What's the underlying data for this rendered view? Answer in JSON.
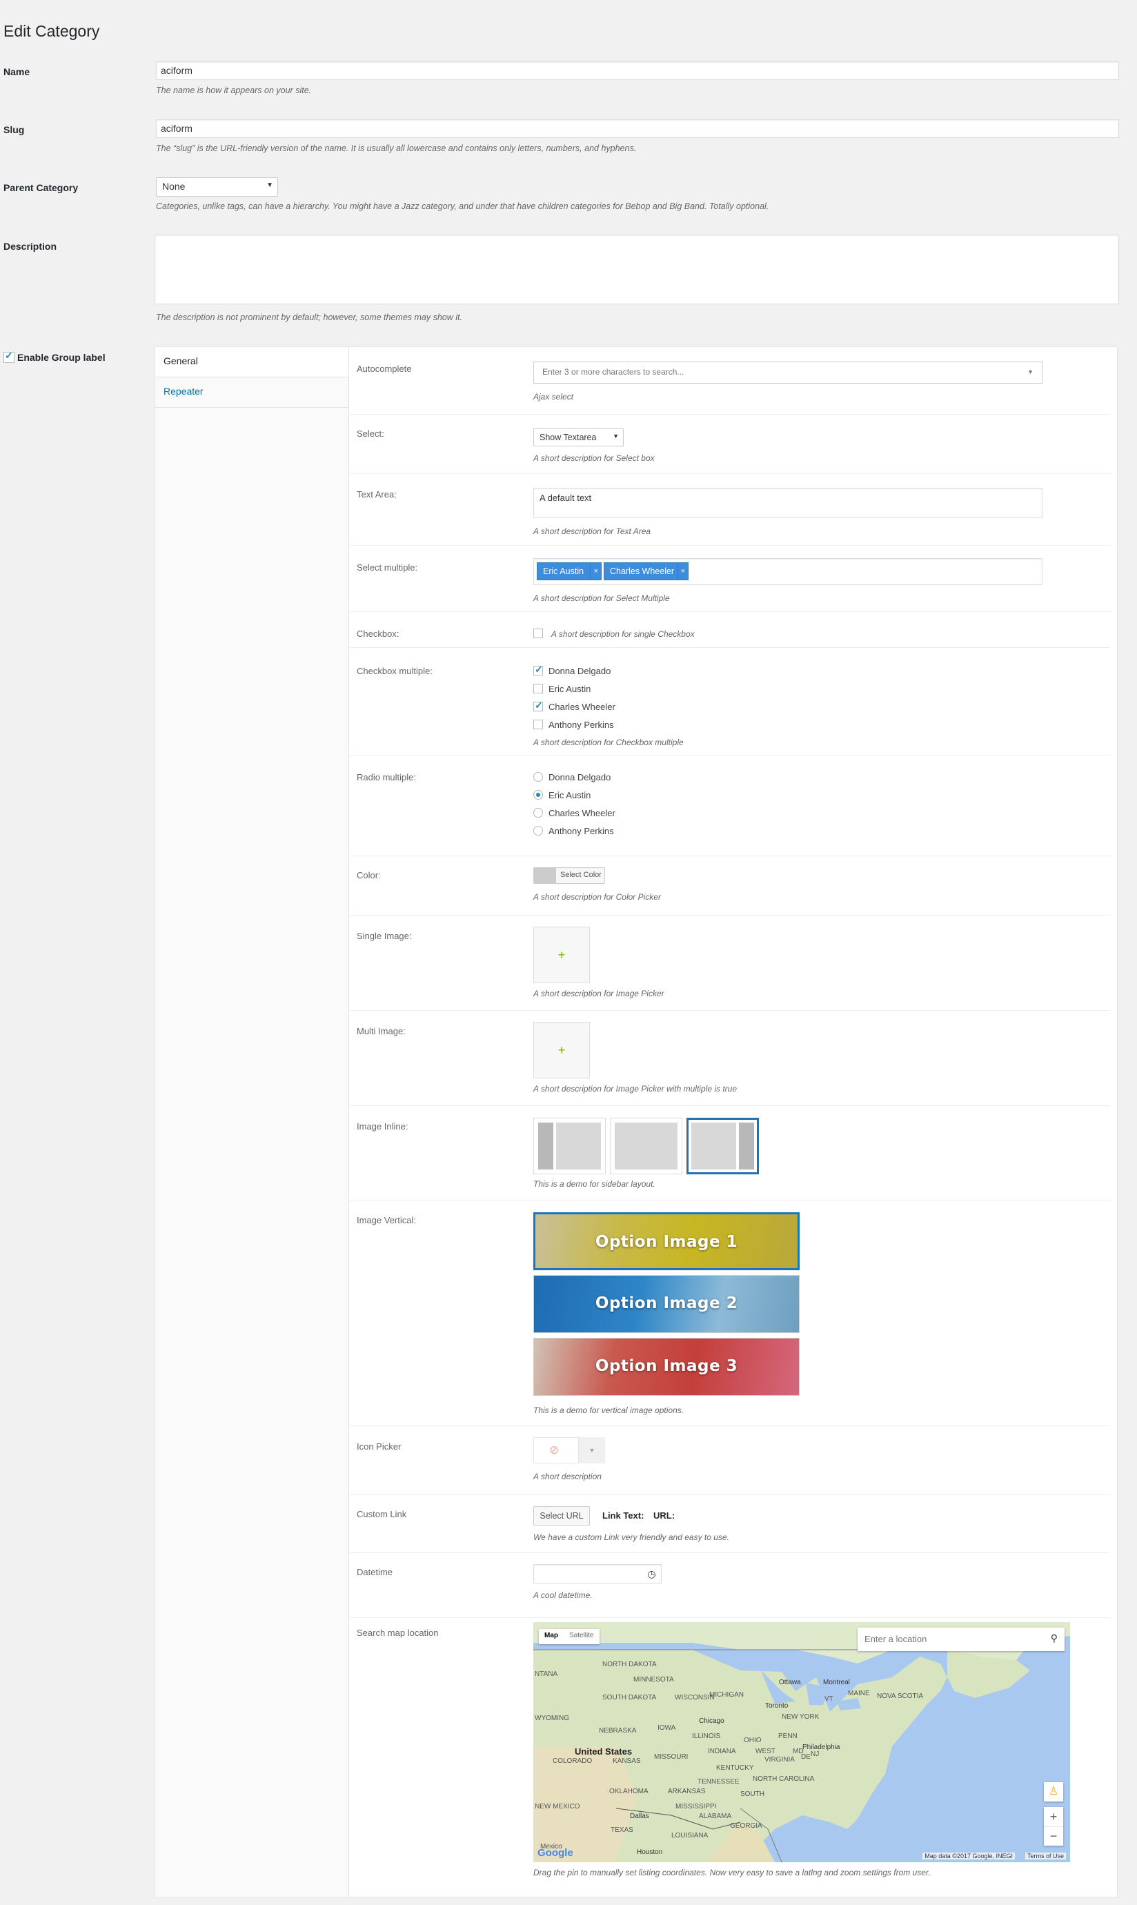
{
  "page": {
    "title": "Edit Category"
  },
  "fields": {
    "name": {
      "label": "Name",
      "value": "aciform",
      "desc": "The name is how it appears on your site."
    },
    "slug": {
      "label": "Slug",
      "value": "aciform",
      "desc": "The “slug” is the URL-friendly version of the name. It is usually all lowercase and contains only letters, numbers, and hyphens."
    },
    "parent": {
      "label": "Parent Category",
      "value": "None",
      "desc": "Categories, unlike tags, can have a hierarchy. You might have a Jazz category, and under that have children categories for Bebop and Big Band. Totally optional."
    },
    "description": {
      "label": "Description",
      "value": "",
      "desc": "The description is not prominent by default; however, some themes may show it."
    },
    "enable_group": {
      "label": "Enable Group label",
      "checked": true
    }
  },
  "tabs": [
    {
      "label": "General",
      "active": true
    },
    {
      "label": "Repeater",
      "active": false
    }
  ],
  "general": {
    "autocomplete": {
      "label": "Autocomplete",
      "placeholder": "Enter 3 or more characters to search...",
      "desc": "Ajax select"
    },
    "select": {
      "label": "Select:",
      "value": "Show Textarea",
      "desc": "A short description for Select box"
    },
    "textarea": {
      "label": "Text Area:",
      "value": "A default text",
      "desc": "A short description for Text Area"
    },
    "select_multiple": {
      "label": "Select multiple:",
      "tags": [
        "Eric Austin",
        "Charles Wheeler"
      ],
      "remove": "×",
      "desc": "A short description for Select Multiple"
    },
    "checkbox": {
      "label": "Checkbox:",
      "desc": "A short description for single Checkbox",
      "checked": false
    },
    "checkbox_multiple": {
      "label": "Checkbox multiple:",
      "options": [
        {
          "label": "Donna Delgado",
          "checked": true
        },
        {
          "label": "Eric Austin",
          "checked": false
        },
        {
          "label": "Charles Wheeler",
          "checked": true
        },
        {
          "label": "Anthony Perkins",
          "checked": false
        }
      ],
      "desc": "A short description for Checkbox multiple"
    },
    "radio_multiple": {
      "label": "Radio multiple:",
      "options": [
        {
          "label": "Donna Delgado",
          "selected": false
        },
        {
          "label": "Eric Austin",
          "selected": true
        },
        {
          "label": "Charles Wheeler",
          "selected": false
        },
        {
          "label": "Anthony Perkins",
          "selected": false
        }
      ]
    },
    "color": {
      "label": "Color:",
      "button": "Select Color",
      "swatch": "#cccccc",
      "desc": "A short description for Color Picker"
    },
    "single_image": {
      "label": "Single Image:",
      "plus": "+",
      "desc": "A short description for Image Picker"
    },
    "multi_image": {
      "label": "Multi Image:",
      "plus": "+",
      "desc": "A short description for Image Picker with multiple is true"
    },
    "image_inline": {
      "label": "Image Inline:",
      "selected_index": 2,
      "desc": "This is a demo for sidebar layout."
    },
    "image_vertical": {
      "label": "Image Vertical:",
      "options": [
        "Option Image 1",
        "Option Image 2",
        "Option Image 3"
      ],
      "selected_index": 0,
      "desc": "This is a demo for vertical image options."
    },
    "icon_picker": {
      "label": "Icon Picker",
      "desc": "A short description"
    },
    "custom_link": {
      "label": "Custom Link",
      "button": "Select URL",
      "link_text_label": "Link Text:",
      "url_label": "URL:",
      "desc": "We have a custom Link very friendly and easy to use."
    },
    "datetime": {
      "label": "Datetime",
      "value": "",
      "desc": "A cool datetime."
    },
    "map": {
      "label": "Search map location",
      "type_map": "Map",
      "type_satellite": "Satellite",
      "search_placeholder": "Enter a location",
      "zoom_in": "+",
      "zoom_out": "−",
      "brand": "Google",
      "attribution": "Map data ©2017 Google, INEGI",
      "terms": "Terms of Use",
      "labels": {
        "nd": "NORTH DAKOTA",
        "mn": "MINNESOTA",
        "mt": "NTANA",
        "sd": "SOUTH DAKOTA",
        "wi": "WISCONSIN",
        "wy": "WYOMING",
        "ne": "NEBRASKA",
        "ia": "IOWA",
        "us": "United States",
        "co": "COLORADO",
        "ks": "KANSAS",
        "mo": "MISSOURI",
        "il": "ILLINOIS",
        "in": "INDIANA",
        "oh": "OHIO",
        "penn": "PENN",
        "nm": "NEW MEXICO",
        "ok": "OKLAHOMA",
        "tx": "TEXAS",
        "ar": "ARKANSAS",
        "ms": "MISSISSIPPI",
        "al": "ALABAMA",
        "ga": "GEORGIA",
        "tn": "TENNESSEE",
        "ky": "KENTUCKY",
        "wv": "WEST",
        "va": "VIRGINIA",
        "nc": "NORTH CAROLINA",
        "sc": "SOUTH",
        "la": "LOUISIANA",
        "chicago": "Chicago",
        "toronto": "Toronto",
        "ottawa": "Ottawa",
        "montreal": "Montreal",
        "maine": "MAINE",
        "ns": "NOVA SCOTIA",
        "ny": "NEW YORK",
        "vt": "VT",
        "philadelphia": "Philadelphia",
        "dallas": "Dallas",
        "houston": "Houston",
        "mexico": "Mexico",
        "md": "MD",
        "de": "DE",
        "nj": "NJ",
        "mi": "MICHIGAN"
      },
      "desc": "Drag the pin to manually set listing coordinates. Now very easy to save a latlng and zoom settings from user."
    }
  }
}
